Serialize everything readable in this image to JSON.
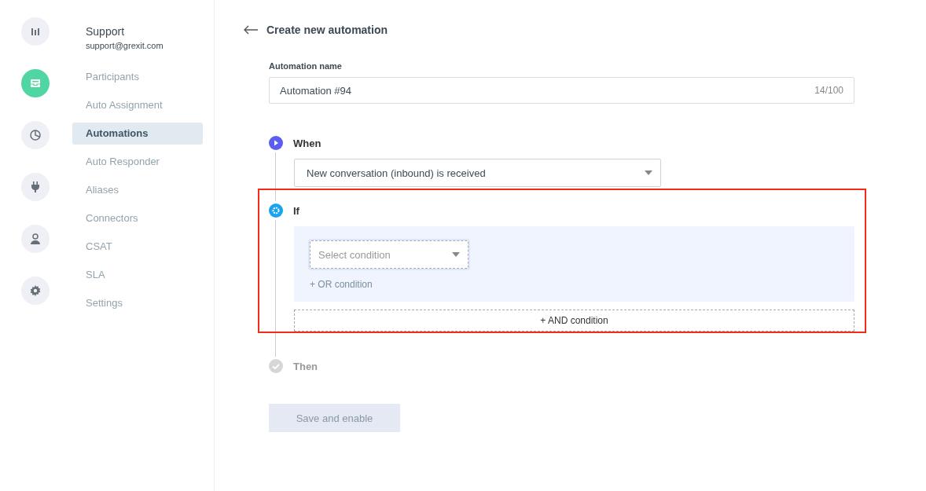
{
  "rail": [
    {
      "kind": "chart",
      "selected": false
    },
    {
      "kind": "inbox",
      "selected": true
    },
    {
      "kind": "pie",
      "selected": false
    },
    {
      "kind": "plug",
      "selected": false
    },
    {
      "kind": "person",
      "selected": false
    },
    {
      "kind": "gear",
      "selected": false
    }
  ],
  "account": {
    "name": "Support",
    "email": "support@grexit.com"
  },
  "sidebar": {
    "items": [
      {
        "label": "Participants",
        "selected": false
      },
      {
        "label": "Auto Assignment",
        "selected": false
      },
      {
        "label": "Automations",
        "selected": true
      },
      {
        "label": "Auto Responder",
        "selected": false
      },
      {
        "label": "Aliases",
        "selected": false
      },
      {
        "label": "Connectors",
        "selected": false
      },
      {
        "label": "CSAT",
        "selected": false
      },
      {
        "label": "SLA",
        "selected": false
      },
      {
        "label": "Settings",
        "selected": false
      }
    ]
  },
  "header": {
    "title": "Create new automation"
  },
  "name_field": {
    "label": "Automation name",
    "value": "Automation #94",
    "counter": "14/100"
  },
  "steps": [
    {
      "kind": "when",
      "label": "When",
      "disabled": false,
      "highlighted": false,
      "select": "New conversation (inbound) is received"
    },
    {
      "kind": "if",
      "label": "If",
      "disabled": false,
      "highlighted": true,
      "placeholder": "Select condition",
      "or_link": "+ OR condition",
      "and_button": "+ AND condition"
    },
    {
      "kind": "then",
      "label": "Then",
      "disabled": true,
      "highlighted": false
    }
  ],
  "save_button": {
    "label": "Save and enable",
    "disabled": true
  }
}
